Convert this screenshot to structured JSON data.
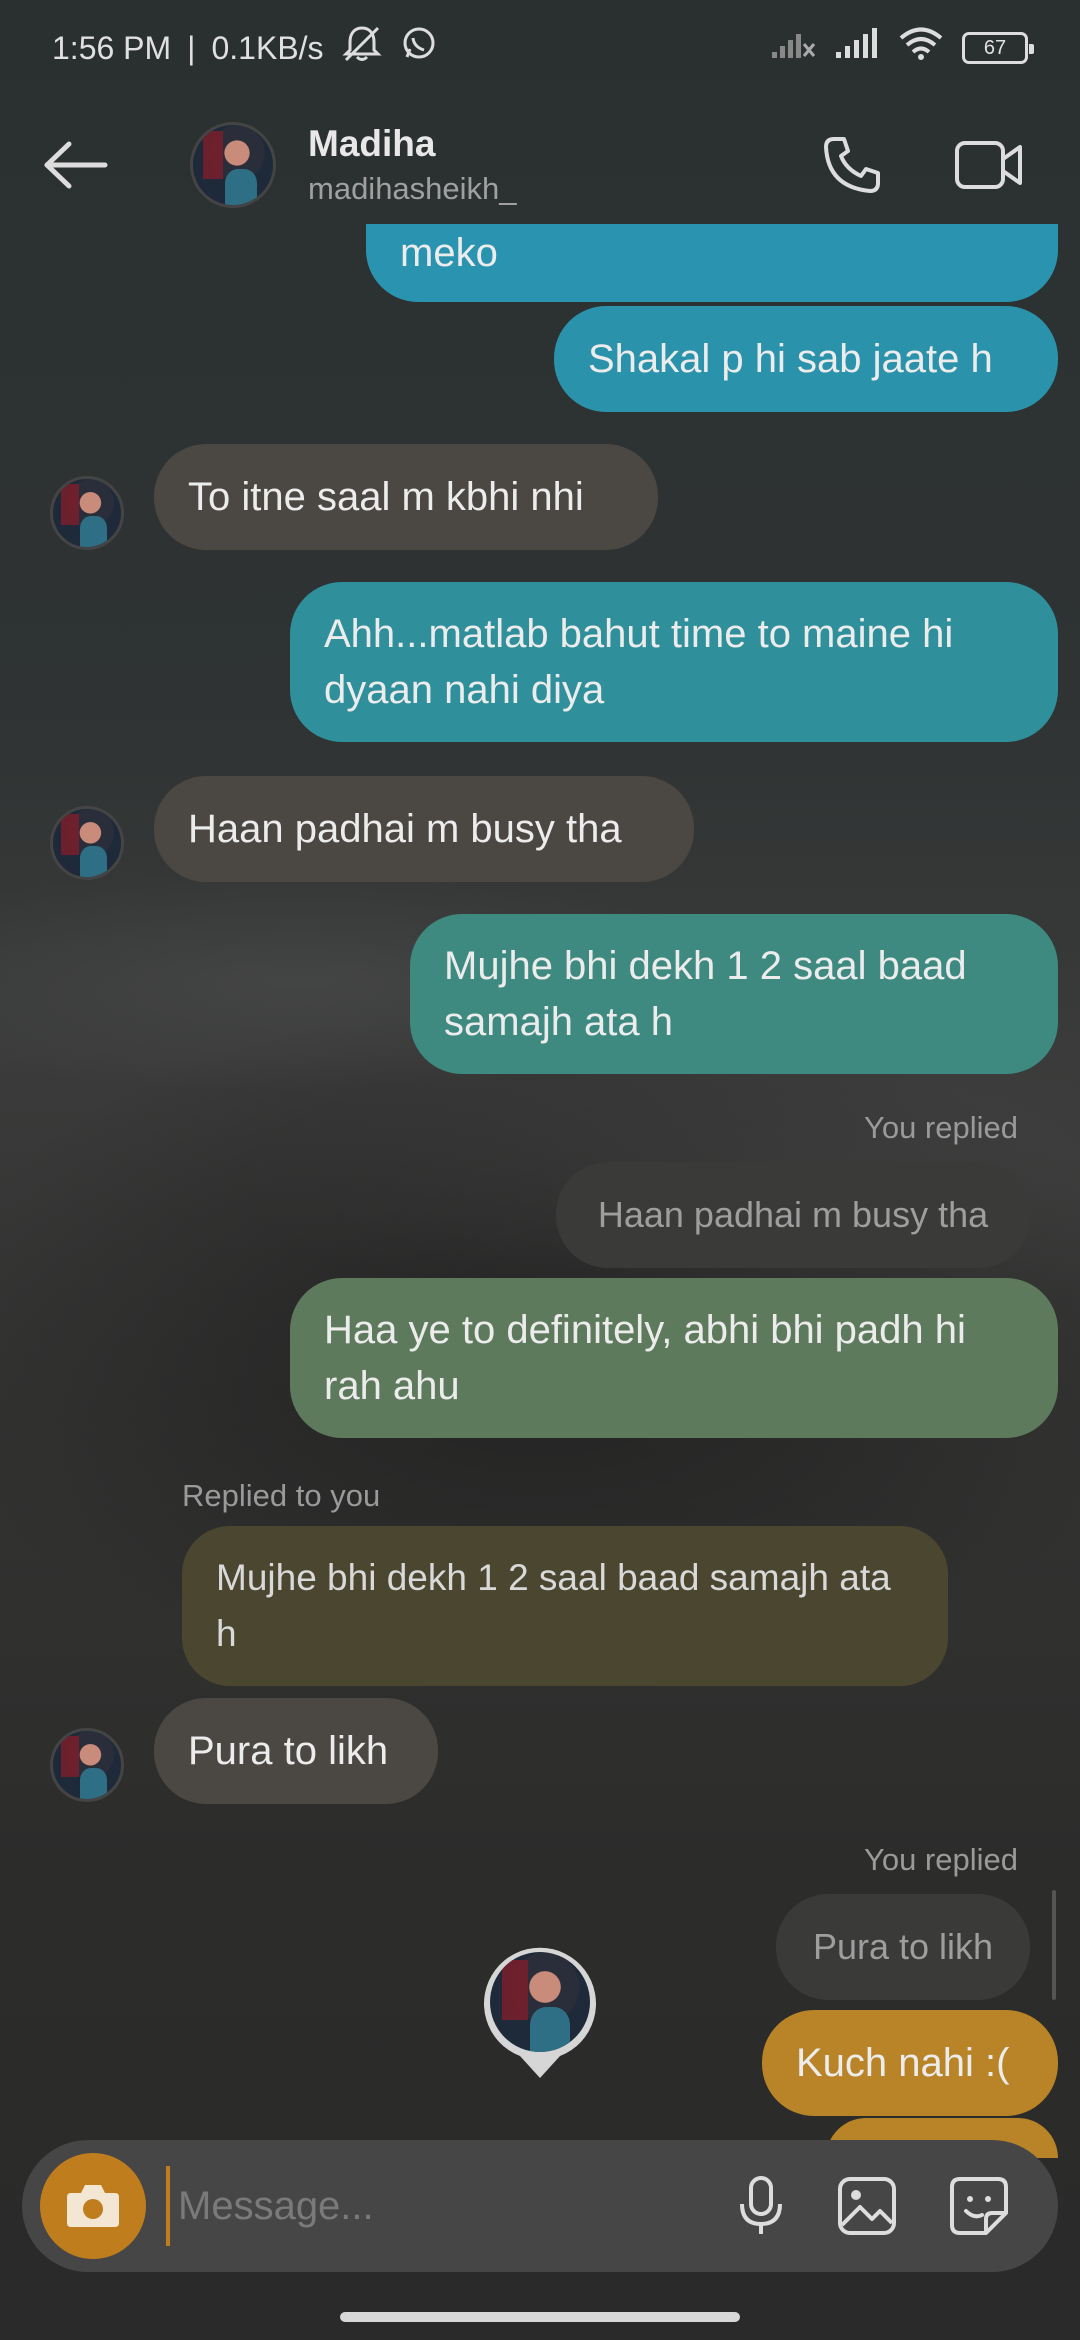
{
  "status_bar": {
    "time": "1:56 PM",
    "separator": "|",
    "speed": "0.1KB/s",
    "battery": "67"
  },
  "header": {
    "name": "Madiha",
    "username": "madihasheikh_"
  },
  "messages": [
    {
      "id": "m1",
      "dir": "out",
      "text": "meko",
      "color": "#2a94b0"
    },
    {
      "id": "m2",
      "dir": "out",
      "text": "Shakal p hi sab jaate h",
      "color": "#2b92ab"
    },
    {
      "id": "m3",
      "dir": "in",
      "text": "To itne saal m kbhi nhi"
    },
    {
      "id": "m4",
      "dir": "out",
      "text": "Ahh...matlab bahut time to maine hi dyaan nahi diya",
      "color": "#2f8f9b"
    },
    {
      "id": "m5",
      "dir": "in",
      "text": "Haan padhai m busy tha"
    },
    {
      "id": "m6",
      "dir": "out",
      "text": "Mujhe bhi dekh 1 2 saal baad samajh ata h",
      "color": "#3e8a80"
    },
    {
      "id": "m7",
      "dir": "out",
      "text": "Haa ye to definitely, abhi bhi padh hi rah ahu",
      "color": "#5e7a5c"
    },
    {
      "id": "m8",
      "dir": "in",
      "text": "Pura to likh"
    },
    {
      "id": "m9",
      "dir": "out",
      "text": "Kuch nahi :(",
      "color": "#b88427"
    }
  ],
  "replies": {
    "r1_label": "You replied",
    "r1_quote": "Haan padhai m busy tha",
    "r2_label": "Replied to you",
    "r2_quote": "Mujhe bhi dekh 1 2 saal baad samajh ata h",
    "r2_color": "#4a4630",
    "r3_label": "You replied",
    "r3_quote": "Pura to likh"
  },
  "composer": {
    "placeholder": "Message...",
    "accent": "#c07d1e"
  }
}
